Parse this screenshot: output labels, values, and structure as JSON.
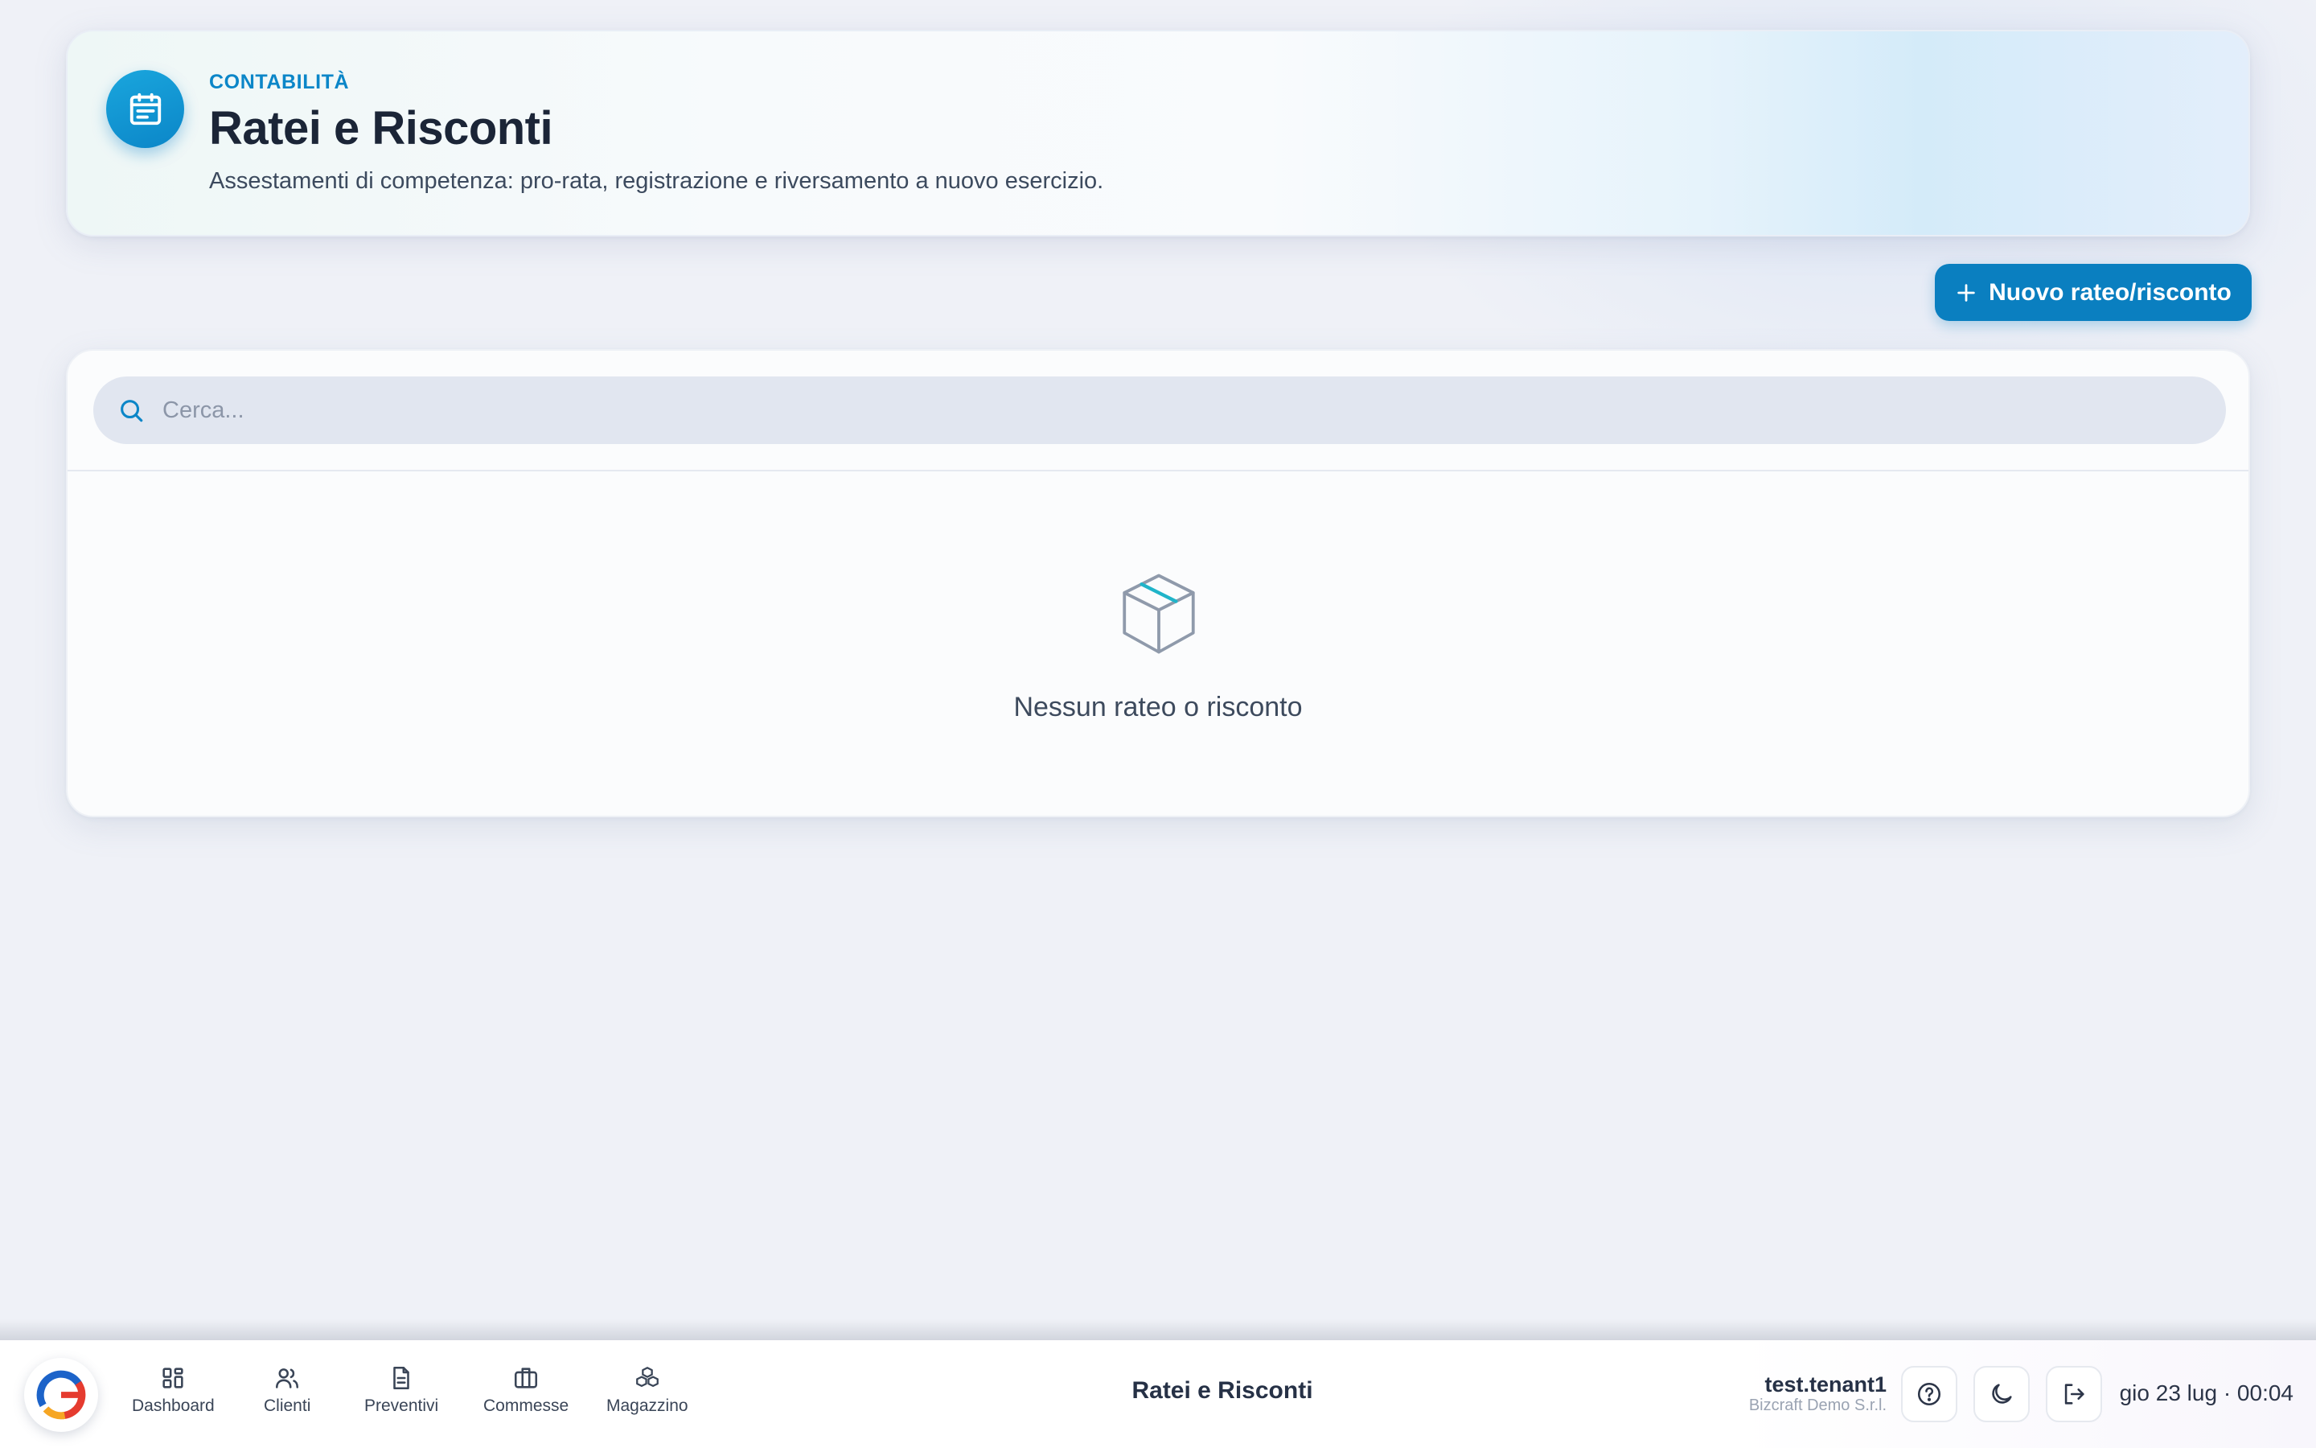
{
  "header": {
    "eyebrow": "CONTABILITÀ",
    "title": "Ratei e Risconti",
    "subtitle": "Assestamenti di competenza: pro-rata, registrazione e riversamento a nuovo esercizio.",
    "icon": "calendar-icon"
  },
  "actions": {
    "new_label": "Nuovo rateo/risconto",
    "new_icon": "plus-icon"
  },
  "search": {
    "placeholder": "Cerca...",
    "value": ""
  },
  "empty_state": {
    "icon": "box-icon",
    "text": "Nessun rateo o risconto"
  },
  "bottom_nav": {
    "items": [
      {
        "label": "Dashboard",
        "icon": "grid-icon"
      },
      {
        "label": "Clienti",
        "icon": "users-icon"
      },
      {
        "label": "Preventivi",
        "icon": "document-icon"
      },
      {
        "label": "Commesse",
        "icon": "briefcase-icon"
      },
      {
        "label": "Magazzino",
        "icon": "boxes-icon"
      }
    ],
    "current_page": "Ratei e Risconti",
    "user": "test.tenant1",
    "company": "Bizcraft Demo S.r.l.",
    "datetime": "gio 23 lug · 00:04"
  },
  "colors": {
    "accent": "#0a7fc0",
    "accent_light": "#1aa6dd",
    "background": "#eff1f7",
    "text": "#1f2a3d"
  }
}
